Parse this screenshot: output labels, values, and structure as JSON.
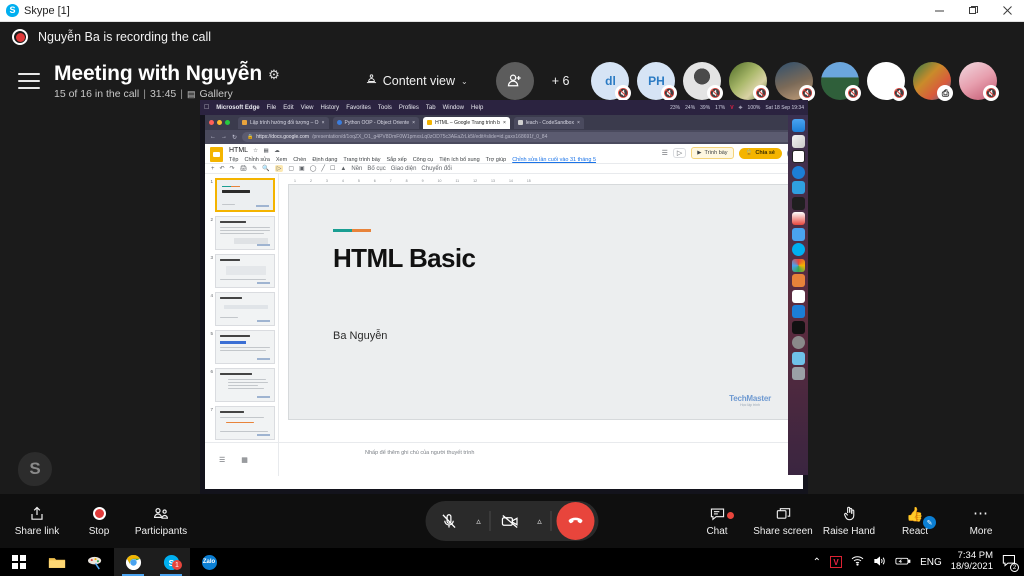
{
  "window": {
    "title": "Skype [1]",
    "app_icon": "skype-icon",
    "minimize": "−",
    "maximize": "❐",
    "close": "✕"
  },
  "recording": {
    "text": "Nguyễn Ba is recording the call",
    "icon": "record-dot-icon"
  },
  "header": {
    "menu_icon": "hamburger-menu-icon",
    "title": "Meeting with Nguyễn",
    "settings_icon": "gear-icon",
    "participants_text": "15 of 16 in the call",
    "separator": "|",
    "duration": "31:45",
    "layout_icon": "gallery-icon",
    "layout_label": "Gallery",
    "content_view": {
      "icon": "presenter-icon",
      "label": "Content view",
      "caret": "⌄"
    },
    "add_person": {
      "icon": "add-person-icon"
    },
    "overflow_count": "+ 6",
    "avatars": [
      {
        "name": "dl",
        "type": "initials",
        "initials": "dl",
        "bg": "#d6e4f5",
        "fg": "#2b7bc4",
        "badge": "mic-muted-icon"
      },
      {
        "name": "PH",
        "type": "initials",
        "initials": "PH",
        "bg": "#d6e4f5",
        "fg": "#2b7bc4",
        "badge": "mic-muted-icon"
      },
      {
        "name": "portrait-bw",
        "type": "photo",
        "bg": "#e8e8e8",
        "fg": "#333",
        "badge": "mic-muted-icon"
      },
      {
        "name": "nature-leaf",
        "type": "photo",
        "bg": "#6f8a3a",
        "fg": "#fff",
        "badge": "mic-muted-icon"
      },
      {
        "name": "blue-scene",
        "type": "photo",
        "bg": "#4a6a8c",
        "fg": "#fff",
        "badge": "mic-muted-icon"
      },
      {
        "name": "mountain-sky",
        "type": "photo",
        "bg": "#3f7ab5",
        "fg": "#fff",
        "badge": "mic-muted-icon"
      },
      {
        "name": "blank-white",
        "type": "blank",
        "bg": "#ffffff",
        "fg": "#999",
        "badge": "mic-muted-icon"
      },
      {
        "name": "group-photo",
        "type": "photo",
        "bg": "#c0842a",
        "fg": "#fff",
        "badge": "screen-share-icon"
      },
      {
        "name": "pink-portrait",
        "type": "photo",
        "bg": "#e0a8b8",
        "fg": "#fff",
        "badge": "mic-muted-icon"
      }
    ]
  },
  "shared_screen": {
    "os": "macOS",
    "menubar": {
      "apple": "",
      "app": "Microsoft Edge",
      "items": [
        "File",
        "Edit",
        "View",
        "History",
        "Favorites",
        "Tools",
        "Profiles",
        "Tab",
        "Window",
        "Help"
      ],
      "stats": [
        "23%",
        "24%",
        "39%",
        "17%"
      ],
      "battery": "100%",
      "clock": "Sat 18 Sep 19:34"
    },
    "browser": {
      "tabs": [
        {
          "title": "Lập trình hướng đối tượng – O",
          "active": false
        },
        {
          "title": "Python OOP - Object Oriente",
          "active": false
        },
        {
          "title": "HTML – Google Trang trình b",
          "active": true
        },
        {
          "title": "leach - CodeSandbox",
          "active": false
        }
      ],
      "url_prefix": "https://docs.google.com",
      "url_suffix": "/presentation/d/1oqZX_O1_g4PV8DmF0W1pmxsLq0zOD75c3AEaZrLk5l/edit#slide=id.gaxx168691f_0_84",
      "back_icon": "back-arrow-icon",
      "forward_icon": "forward-arrow-icon",
      "reload_icon": "reload-icon",
      "lock_icon": "lock-icon"
    },
    "slides_app": {
      "doc_name": "HTML",
      "star_icons": [
        "star-icon",
        "move-icon",
        "cloud-icon"
      ],
      "menu": [
        "Tệp",
        "Chỉnh sửa",
        "Xem",
        "Chèn",
        "Định dạng",
        "Trang trình bày",
        "Sắp xếp",
        "Công cụ",
        "Tiện ích bổ sung",
        "Trợ giúp"
      ],
      "last_edit": "Chỉnh sửa lần cuối vào 31 tháng 5",
      "present_button": "Trình bày",
      "share_button": "Chia sẻ",
      "toolbar_items": [
        "+",
        "↶",
        "↷",
        "🖶",
        "🖌",
        "🔍",
        "↖",
        "▣",
        "▤",
        "▨",
        "＼",
        "⊞",
        "⬆",
        "Nền",
        "Bố cục",
        "Giao diện",
        "Chuyển đổi"
      ],
      "slide_count": 8,
      "selected_slide": 1,
      "notes_placeholder": "Nhấp để thêm ghi chú của người thuyết trình"
    },
    "slide": {
      "accent_colors": [
        "#1a9e92",
        "#e8833a"
      ],
      "title": "HTML Basic",
      "author": "Ba Nguyễn",
      "logo_name": "TechMaster",
      "logo_tagline": "Học lập trình"
    }
  },
  "call_bar": {
    "left": [
      {
        "label": "Share link",
        "icon": "share-link-icon"
      },
      {
        "label": "Stop",
        "icon": "stop-recording-icon"
      },
      {
        "label": "Participants",
        "icon": "participants-icon"
      }
    ],
    "center": {
      "mic": {
        "icon": "mic-muted-icon",
        "caret": "⌃"
      },
      "camera": {
        "icon": "camera-off-icon",
        "caret": "⌃"
      },
      "end_call": {
        "icon": "end-call-icon"
      }
    },
    "right": [
      {
        "label": "Chat",
        "icon": "chat-icon",
        "badge": "unread-dot"
      },
      {
        "label": "Share screen",
        "icon": "share-screen-icon",
        "badge": ""
      },
      {
        "label": "Raise Hand",
        "icon": "raise-hand-icon",
        "badge": ""
      },
      {
        "label": "React",
        "icon": "thumbs-up-icon",
        "badge": "edit-pen"
      },
      {
        "label": "More",
        "icon": "more-options-icon",
        "badge": ""
      }
    ]
  },
  "watermark": {
    "letter": "S"
  },
  "taskbar": {
    "apps": [
      {
        "name": "start-button",
        "icon": "windows-logo-icon",
        "active": false
      },
      {
        "name": "file-explorer",
        "icon": "folder-icon",
        "active": false
      },
      {
        "name": "paint-3d",
        "icon": "paint-icon",
        "active": false
      },
      {
        "name": "google-chrome",
        "icon": "chrome-icon",
        "active": true
      },
      {
        "name": "skype",
        "icon": "skype-icon",
        "active": true,
        "badge": "1"
      },
      {
        "name": "zalo",
        "icon": "zalo-icon",
        "active": false
      }
    ],
    "tray": {
      "chevron": "⌃",
      "unikey": "V",
      "wifi_icon": "wifi-icon",
      "volume_icon": "volume-icon",
      "battery_icon": "battery-icon",
      "language": "ENG",
      "time": "7:34 PM",
      "date": "18/9/2021",
      "notifications_icon": "notification-icon",
      "notifications_count": "2"
    }
  }
}
